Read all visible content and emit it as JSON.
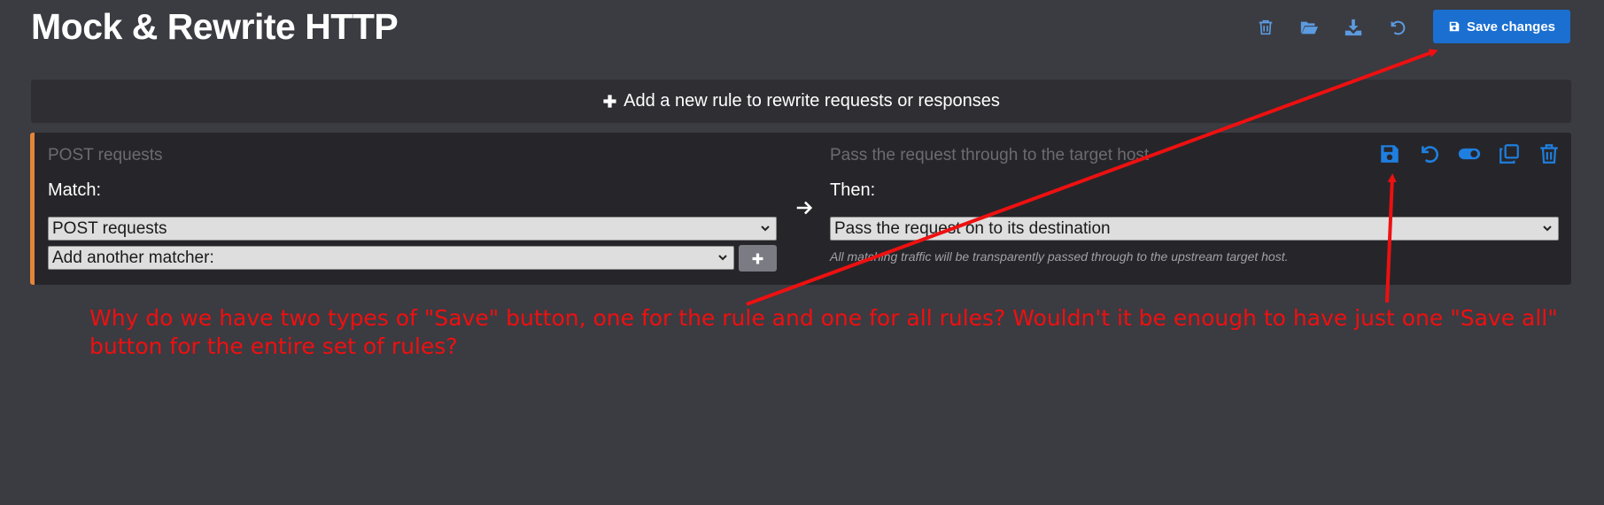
{
  "page": {
    "title": "Mock & Rewrite HTTP"
  },
  "header": {
    "icons": [
      "trash-icon",
      "folder-open-icon",
      "download-icon",
      "undo-icon"
    ],
    "save_changes_label": "Save changes"
  },
  "add_rule": {
    "label": "Add a new rule to rewrite requests or responses"
  },
  "rule": {
    "match_summary": "POST requests",
    "action_summary": "Pass the request through to the target host",
    "match_label": "Match:",
    "then_label": "Then:",
    "matcher_value": "POST requests",
    "add_matcher_value": "Add another matcher:",
    "handler_value": "Pass the request on to its destination",
    "handler_description": "All matching traffic will be transparently passed through to the upstream target host.",
    "icons": [
      "save-icon",
      "undo-icon",
      "toggle-icon",
      "clone-icon",
      "trash-icon"
    ]
  },
  "annotation": {
    "text": "Why do we have two types of \"Save\" button, one for the rule and one for all rules? Wouldn't it be enough to have just one \"Save all\" button for the entire set of rules?"
  },
  "colors": {
    "background": "#3b3b42",
    "accent_blue": "#1a6fd1",
    "icon_blue": "#1f7fe0",
    "rule_border": "#e5853a",
    "annotation_red": "#ee1010"
  }
}
